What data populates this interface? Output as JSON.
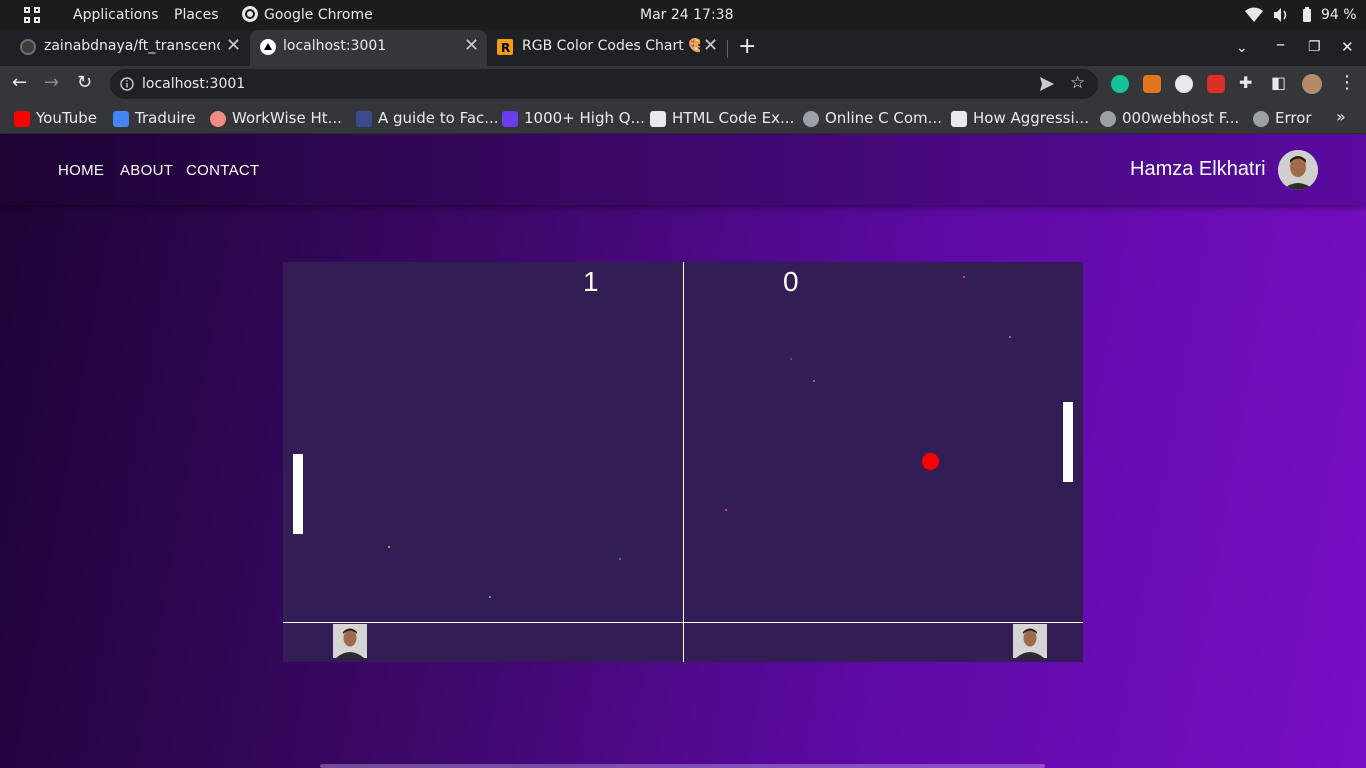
{
  "system_bar": {
    "applications": "Applications",
    "places": "Places",
    "active_app": "Google Chrome",
    "datetime": "Mar 24  17:38",
    "battery": "94 %",
    "icons": [
      "wifi-icon",
      "volume-icon",
      "battery-icon"
    ]
  },
  "tabs": [
    {
      "title": "zainabdnaya/ft_transcendence",
      "icon": "github-icon",
      "active": false
    },
    {
      "title": "localhost:3001",
      "icon": "nextjs-icon",
      "active": true
    },
    {
      "title": "RGB Color Codes Chart 🎨",
      "icon": "rapidtables-icon",
      "active": false
    }
  ],
  "toolbar": {
    "url": "localhost:3001"
  },
  "bookmarks": [
    {
      "label": "YouTube",
      "color": "#ff0000"
    },
    {
      "label": "Traduire",
      "color": "#4285f4"
    },
    {
      "label": "WorkWise Ht...",
      "color": "#f28b82"
    },
    {
      "label": "A guide to Fac...",
      "color": "#3b4b8c"
    },
    {
      "label": "1000+ High Q...",
      "color": "#6a3cf0"
    },
    {
      "label": "HTML Code Ex...",
      "color": "#e8eaed"
    },
    {
      "label": "Online C Com...",
      "color": "#9aa0a6"
    },
    {
      "label": "How Aggressi...",
      "color": "#e8eaed"
    },
    {
      "label": "000webhost F...",
      "color": "#9aa0a6"
    },
    {
      "label": "Error",
      "color": "#9aa0a6"
    }
  ],
  "nav": {
    "home": "HOME",
    "about": "ABOUT",
    "contact": "CONTACT",
    "username": "Hamza Elkhatri"
  },
  "game": {
    "score_left": "1",
    "score_right": "0",
    "ball_color": "#ff0000",
    "background": "#331d55"
  },
  "colors": {
    "page_gradient_start": "#1e0435",
    "page_gradient_end": "#780fc4"
  }
}
